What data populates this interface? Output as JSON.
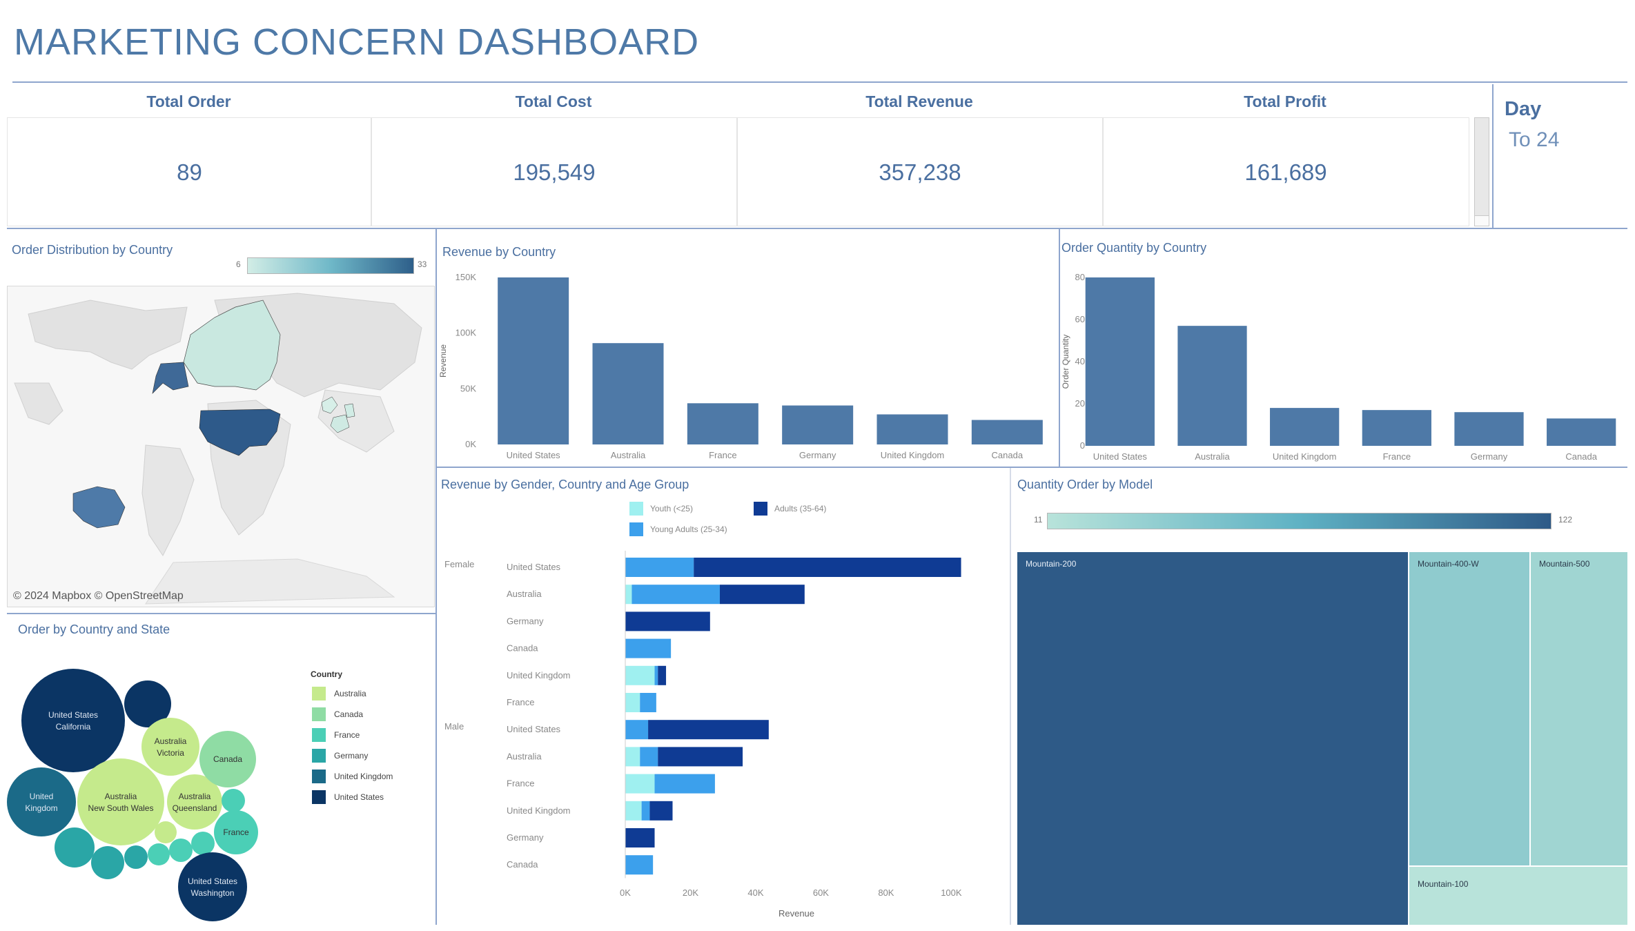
{
  "title": "MARKETING CONCERN DASHBOARD",
  "kpis": [
    {
      "label": "Total Order",
      "value": "89"
    },
    {
      "label": "Total Cost",
      "value": "195,549"
    },
    {
      "label": "Total Revenue",
      "value": "357,238"
    },
    {
      "label": "Total Profit",
      "value": "161,689"
    }
  ],
  "day_filter": {
    "label": "Day",
    "value": "To 24"
  },
  "map": {
    "title": "Order Distribution by Country",
    "scale_min": "6",
    "scale_max": "33",
    "attribution": "© 2024 Mapbox © OpenStreetMap",
    "colors": {
      "low": "#d2ede6",
      "high": "#2e5f8a"
    }
  },
  "bubbles": {
    "title": "Order by Country and State",
    "legend_title": "Country",
    "legend": [
      {
        "name": "Australia",
        "color": "#c5ea8c"
      },
      {
        "name": "Canada",
        "color": "#8fdca4"
      },
      {
        "name": "France",
        "color": "#4bcfb6"
      },
      {
        "name": "Germany",
        "color": "#2aa6a6"
      },
      {
        "name": "United Kingdom",
        "color": "#1b6a88"
      },
      {
        "name": "United States",
        "color": "#0b3564"
      }
    ],
    "labels": {
      "us_ca": [
        "United States",
        "California"
      ],
      "uk": [
        "United",
        "Kingdom"
      ],
      "au_nsw": [
        "Australia",
        "New South Wales"
      ],
      "au_vic": [
        "Australia",
        "Victoria"
      ],
      "au_qld": [
        "Australia",
        "Queensland"
      ],
      "canada": [
        "Canada"
      ],
      "france": [
        "France"
      ],
      "us_wa": [
        "United States",
        "Washington"
      ]
    }
  },
  "treemap": {
    "title": "Quantity Order by Model",
    "scale_min": "11",
    "scale_max": "122",
    "items": [
      {
        "name": "Mountain-200",
        "color": "#2e5a87"
      },
      {
        "name": "Mountain-400-W",
        "color": "#8fcbce"
      },
      {
        "name": "Mountain-500",
        "color": "#a0d5d2"
      },
      {
        "name": "Mountain-100",
        "color": "#b8e3da"
      }
    ]
  },
  "chart_data": [
    {
      "type": "bar",
      "title": "Revenue by Country",
      "ylabel": "Revenue",
      "categories": [
        "United States",
        "Australia",
        "France",
        "Germany",
        "United Kingdom",
        "Canada"
      ],
      "values": [
        150000,
        91000,
        37000,
        35000,
        27000,
        22000
      ],
      "yticks": [
        "0K",
        "50K",
        "100K",
        "150K"
      ],
      "ylim": [
        0,
        150000
      ],
      "color": "#4e79a7"
    },
    {
      "type": "bar",
      "title": "Order Quantity by Country",
      "ylabel": "Order Quantity",
      "categories": [
        "United States",
        "Australia",
        "United Kingdom",
        "France",
        "Germany",
        "Canada"
      ],
      "values": [
        80,
        57,
        18,
        17,
        16,
        13
      ],
      "yticks": [
        "0",
        "20",
        "40",
        "60",
        "80"
      ],
      "ylim": [
        0,
        80
      ],
      "color": "#4e79a7"
    },
    {
      "type": "bar",
      "orientation": "horizontal-stacked",
      "title": "Revenue by Gender, Country and Age Group",
      "xlabel": "Revenue",
      "xticks": [
        "0K",
        "20K",
        "40K",
        "60K",
        "80K",
        "100K"
      ],
      "xlim": [
        0,
        105000
      ],
      "legend_left": [
        "Youth (<25)",
        "Young Adults (25-34)"
      ],
      "legend_right": [
        "Adults (35-64)"
      ],
      "series": [
        {
          "name": "Youth (<25)",
          "color": "#9ff0f0"
        },
        {
          "name": "Young Adults (25-34)",
          "color": "#3ca0ec"
        },
        {
          "name": "Adults (35-64)",
          "color": "#0f3b94"
        }
      ],
      "groups": [
        {
          "gender": "Female",
          "rows": [
            {
              "country": "United States",
              "values": [
                0,
                21000,
                82000
              ]
            },
            {
              "country": "Australia",
              "values": [
                2000,
                27000,
                26000
              ]
            },
            {
              "country": "Germany",
              "values": [
                0,
                0,
                26000
              ]
            },
            {
              "country": "Canada",
              "values": [
                0,
                14000,
                0
              ]
            },
            {
              "country": "United Kingdom",
              "values": [
                9000,
                1000,
                2500
              ]
            },
            {
              "country": "France",
              "values": [
                4500,
                5000,
                0
              ]
            }
          ]
        },
        {
          "gender": "Male",
          "rows": [
            {
              "country": "United States",
              "values": [
                0,
                7000,
                37000
              ]
            },
            {
              "country": "Australia",
              "values": [
                4500,
                5500,
                26000
              ]
            },
            {
              "country": "France",
              "values": [
                9000,
                18500,
                0
              ]
            },
            {
              "country": "United Kingdom",
              "values": [
                5000,
                2500,
                7000
              ]
            },
            {
              "country": "Germany",
              "values": [
                0,
                0,
                9000
              ]
            },
            {
              "country": "Canada",
              "values": [
                0,
                8500,
                0
              ]
            }
          ]
        }
      ]
    }
  ]
}
